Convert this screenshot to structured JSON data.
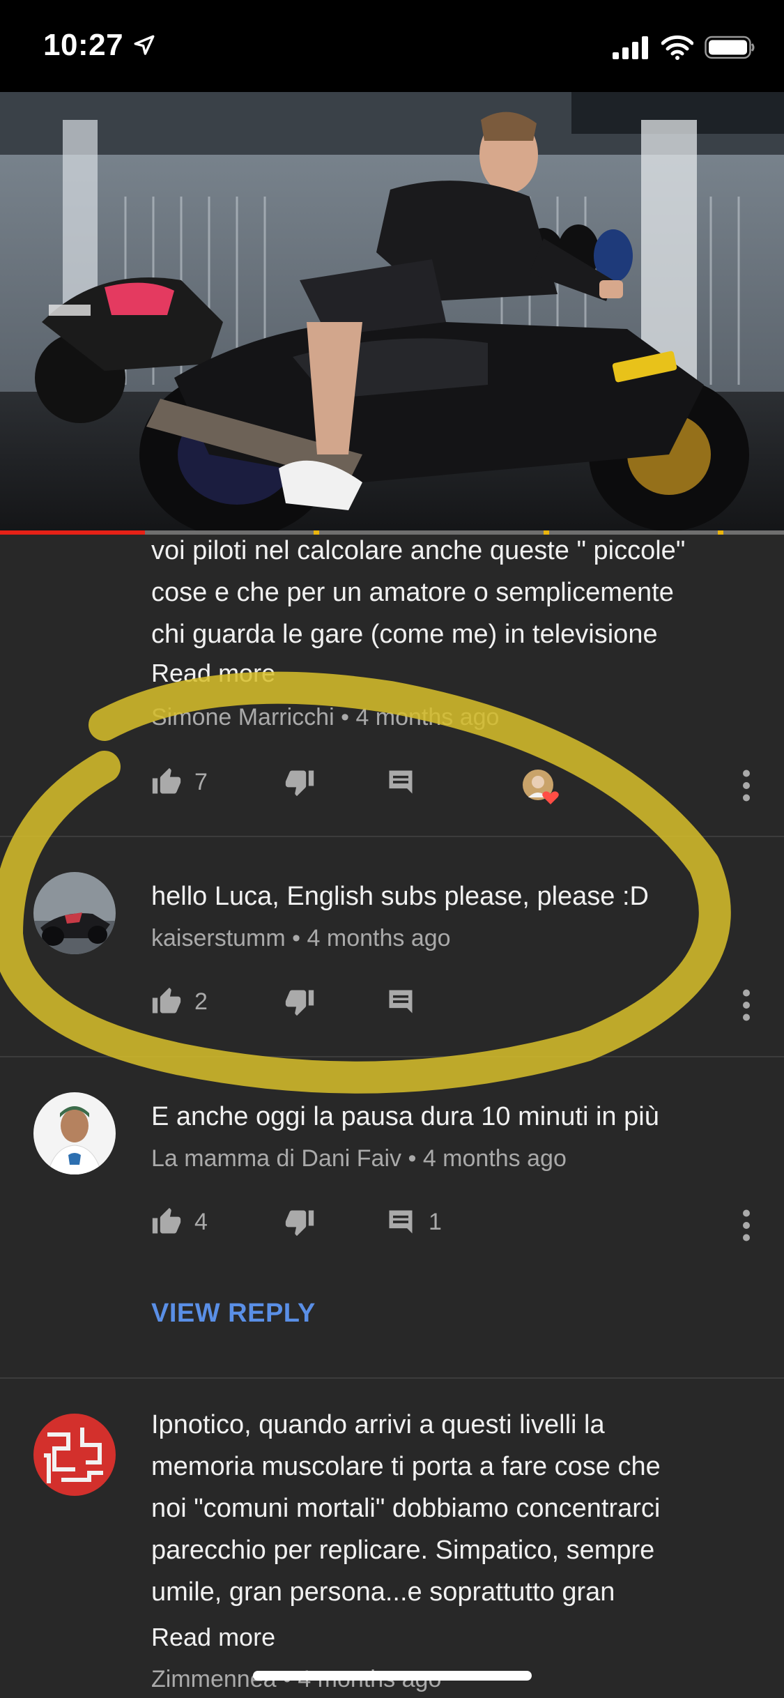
{
  "status_bar": {
    "time": "10:27",
    "icons": [
      "location-arrow-icon",
      "signal-bars-icon",
      "wifi-icon",
      "battery-icon"
    ]
  },
  "video": {
    "watched_fraction": 0.185,
    "accent_color": "#e62117"
  },
  "comments": [
    {
      "text_lines": [
        "voi piloti nel calcolare anche queste \" piccole\"",
        "cose e che per un amatore o semplicemente",
        "chi guarda le gare (come me) in televisione"
      ],
      "read_more": "Read more",
      "author": "Simone Marricchi",
      "separator": "•",
      "time": "4 months ago",
      "likes": "7",
      "replies": "",
      "hearted": true
    },
    {
      "text_lines": [
        "hello Luca, English subs please, please :D"
      ],
      "author": "kaiserstumm",
      "separator": "•",
      "time": "4 months ago",
      "likes": "2",
      "replies": ""
    },
    {
      "text_lines": [
        "E anche oggi la pausa dura 10 minuti in più"
      ],
      "author": "La mamma di Dani Faiv",
      "separator": "•",
      "time": "4 months ago",
      "likes": "4",
      "replies": "1",
      "view_reply": "VIEW REPLY"
    },
    {
      "text_lines": [
        "Ipnotico, quando arrivi a questi livelli la",
        "memoria muscolare ti porta a fare cose che",
        "noi \"comuni mortali\" dobbiamo concentrarci",
        "parecchio per replicare. Simpatico, sempre",
        "umile, gran persona...e soprattutto gran"
      ],
      "read_more": "Read more",
      "author": "Zimmennea",
      "separator": "•",
      "time": "4 months ago"
    }
  ],
  "colors": {
    "background": "#282828",
    "meta_text": "#aaaaaa",
    "link_blue": "#5a8fe6",
    "annotation_yellow": "#d8c02a"
  }
}
